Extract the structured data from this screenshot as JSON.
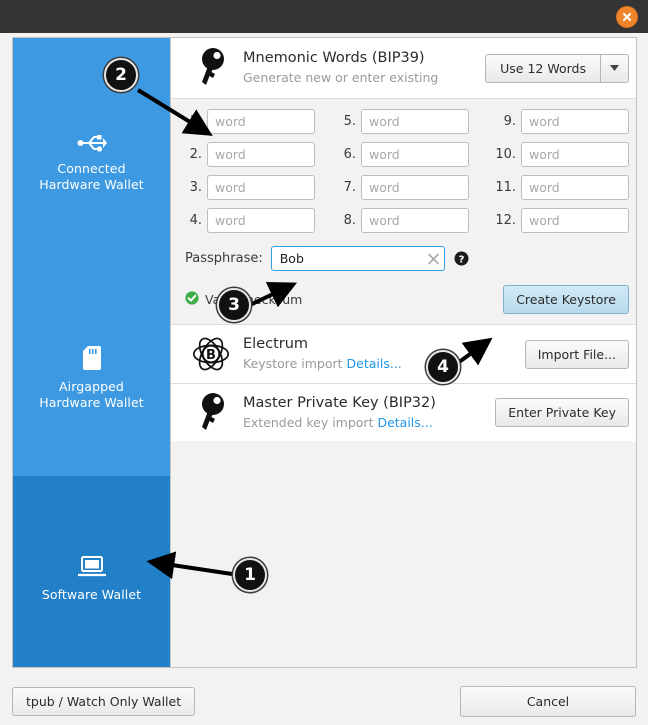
{
  "window": {
    "close_icon": "close-icon"
  },
  "sidebar": {
    "items": [
      {
        "icon": "usb-icon",
        "label_line1": "Connected",
        "label_line2": "Hardware Wallet",
        "selected": false
      },
      {
        "icon": "sdcard-icon",
        "label_line1": "Airgapped",
        "label_line2": "Hardware Wallet",
        "selected": false
      },
      {
        "icon": "laptop-icon",
        "label_line1": "Software Wallet",
        "label_line2": "",
        "selected": true
      }
    ]
  },
  "main": {
    "mnemonic": {
      "icon": "key-icon",
      "title": "Mnemonic Words (BIP39)",
      "subtitle": "Generate new or enter existing",
      "words_button": "Use 12 Words",
      "words_button_arrow": "chevron-down-icon",
      "word_placeholder": "word",
      "words": [
        {
          "num": "1.",
          "value": "",
          "placeholder": "word"
        },
        {
          "num": "2.",
          "value": "",
          "placeholder": "word"
        },
        {
          "num": "3.",
          "value": "",
          "placeholder": "word"
        },
        {
          "num": "4.",
          "value": "",
          "placeholder": "word"
        },
        {
          "num": "5.",
          "value": "",
          "placeholder": "word"
        },
        {
          "num": "6.",
          "value": "",
          "placeholder": "word"
        },
        {
          "num": "7.",
          "value": "",
          "placeholder": "word"
        },
        {
          "num": "8.",
          "value": "",
          "placeholder": "word"
        },
        {
          "num": "9.",
          "value": "",
          "placeholder": "word"
        },
        {
          "num": "10.",
          "value": "",
          "placeholder": "word"
        },
        {
          "num": "11.",
          "value": "",
          "placeholder": "word"
        },
        {
          "num": "12.",
          "value": "",
          "placeholder": "word"
        }
      ],
      "passphrase_label": "Passphrase:",
      "passphrase_value": "Bob",
      "passphrase_clear_icon": "clear-x-icon",
      "passphrase_help_icon": "help-icon",
      "checksum_icon": "valid-check-icon",
      "checksum_text": "Valid checksum",
      "create_button": "Create Keystore"
    },
    "electrum": {
      "icon": "electrum-icon",
      "title": "Electrum",
      "subtitle": "Keystore import",
      "details_link": "Details...",
      "button": "Import File..."
    },
    "masterkey": {
      "icon": "key-icon",
      "title": "Master Private Key (BIP32)",
      "subtitle": "Extended key import",
      "details_link": "Details...",
      "button": "Enter Private Key"
    }
  },
  "footer": {
    "tpub_button": "tpub / Watch Only Wallet",
    "cancel_button": "Cancel"
  },
  "callouts": [
    {
      "num": "1",
      "target": "software-wallet-sidebar-item"
    },
    {
      "num": "2",
      "target": "mnemonic-word-1-input"
    },
    {
      "num": "3",
      "target": "passphrase-input"
    },
    {
      "num": "4",
      "target": "create-keystore-button"
    }
  ],
  "colors": {
    "sidebar_blue": "#3d9ae2",
    "sidebar_selected_blue": "#2280c8",
    "accent_link": "#2196e8",
    "close_orange": "#f0842a",
    "valid_green": "#3fae49",
    "focus_blue": "#2aa1e0",
    "titlebar": "#343434"
  }
}
